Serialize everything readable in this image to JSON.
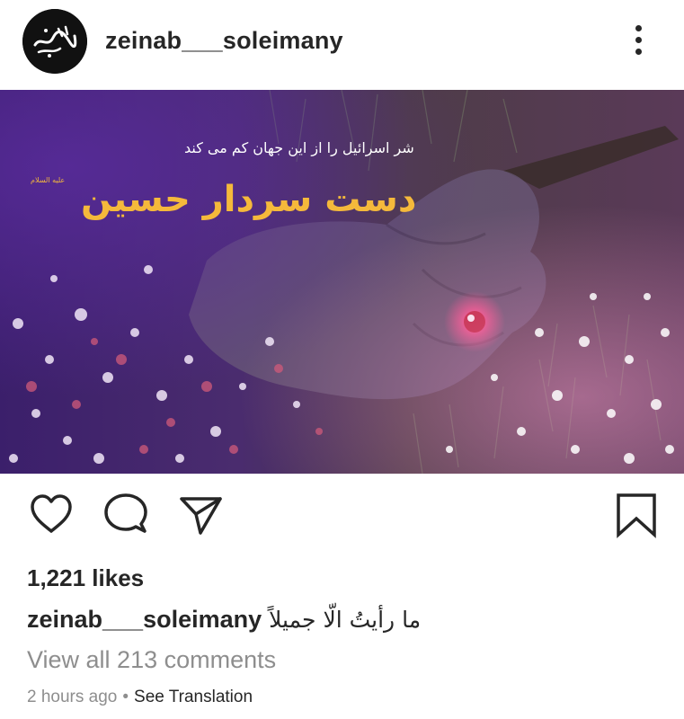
{
  "post": {
    "username": "zeinab___soleimany",
    "likes": "1,221 likes",
    "caption_user": "zeinab___soleimany",
    "caption_text": "ما رأیتُ الّا جمیلاً",
    "view_comments": "View all 213 comments",
    "timestamp": "2 hours ago",
    "meta_separator": "•",
    "see_translation": "See Translation"
  },
  "image": {
    "subtitle": "شر اسرائیل را از این جهان کم می کند",
    "title": "دست سردار حسین",
    "honorific": "علیه السلام"
  },
  "icons": {
    "more": "more-vertical-icon",
    "like": "heart-icon",
    "comment": "comment-icon",
    "share": "paper-plane-icon",
    "save": "bookmark-icon"
  },
  "colors": {
    "text": "#262626",
    "secondary": "#8e8e8e",
    "title_gold": "#f5b93b"
  }
}
